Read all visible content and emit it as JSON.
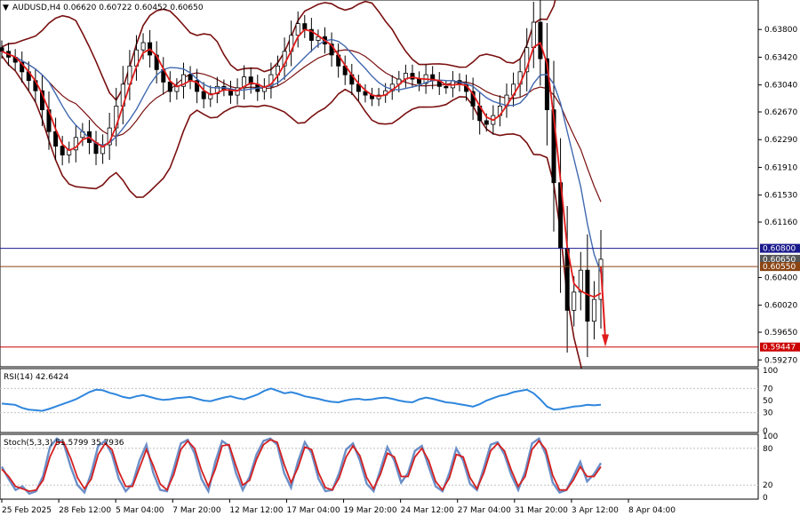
{
  "header": {
    "symbol_line": "AUDUSD,H4  0.06620 0.60722 0.60452 0.60650",
    "caret": "▼"
  },
  "chart_data": [
    {
      "type": "candlestick",
      "pane": "price",
      "symbol": "AUDUSD",
      "timeframe": "H4",
      "ohlc": {
        "open": 0.6062,
        "high": 0.60722,
        "low": 0.60452,
        "close": 0.6065
      },
      "ylim": [
        0.592,
        0.6418
      ],
      "y_ticks": [
        "0.63800",
        "0.63420",
        "0.63040",
        "0.62670",
        "0.62290",
        "0.61910",
        "0.61530",
        "0.61160",
        "0.60400",
        "0.60020",
        "0.59650",
        "0.59270"
      ],
      "x_ticks": [
        "25 Feb 2025",
        "28 Feb 12:00",
        "5 Mar 04:00",
        "7 Mar 20:00",
        "12 Mar 12:00",
        "17 Mar 04:00",
        "19 Mar 20:00",
        "24 Mar 12:00",
        "27 Mar 04:00",
        "31 Mar 20:00",
        "3 Apr 12:00",
        "8 Apr 04:00"
      ],
      "path_close": [
        0.635,
        0.6342,
        0.6335,
        0.6322,
        0.631,
        0.6296,
        0.627,
        0.624,
        0.622,
        0.6208,
        0.6215,
        0.6232,
        0.624,
        0.6225,
        0.621,
        0.6222,
        0.6245,
        0.6275,
        0.6305,
        0.633,
        0.6352,
        0.6362,
        0.6345,
        0.6325,
        0.6308,
        0.6295,
        0.6302,
        0.6318,
        0.631,
        0.6295,
        0.6285,
        0.6292,
        0.6302,
        0.6298,
        0.629,
        0.63,
        0.6315,
        0.6305,
        0.6295,
        0.6302,
        0.6318,
        0.633,
        0.635,
        0.6372,
        0.6388,
        0.638,
        0.6365,
        0.637,
        0.636,
        0.6345,
        0.633,
        0.6318,
        0.6305,
        0.6295,
        0.629,
        0.6285,
        0.629,
        0.6296,
        0.6305,
        0.6312,
        0.632,
        0.6312,
        0.6306,
        0.6318,
        0.631,
        0.6302,
        0.63,
        0.631,
        0.6305,
        0.6295,
        0.6275,
        0.6255,
        0.625,
        0.6262,
        0.6275,
        0.629,
        0.6305,
        0.6322,
        0.6355,
        0.639,
        0.634,
        0.627,
        0.617,
        0.608,
        0.5995,
        0.602,
        0.605,
        0.598,
        0.601,
        0.6065
      ],
      "lines": {
        "ema_red": "close smoothing, red",
        "ma_blue": "slower moving average, steel blue",
        "bollinger": "upper/lower bands, dark red"
      },
      "horizontal_levels": [
        {
          "price": 0.608,
          "label": "0.60800",
          "color": "#1a1a8c"
        },
        {
          "price": 0.6065,
          "label": "0.60650",
          "color": "#555555"
        },
        {
          "price": 0.6055,
          "label": "0.60550",
          "color": "#8b4513"
        },
        {
          "price": 0.59447,
          "label": "0.59447",
          "color": "#cc0000"
        }
      ]
    },
    {
      "type": "line",
      "pane": "rsi",
      "title": "RSI(14) 42.6424",
      "ylim": [
        0,
        100
      ],
      "y_ticks": [
        "100",
        "70",
        "50",
        "30",
        "0"
      ],
      "values": [
        45,
        44,
        43,
        38,
        35,
        34,
        33,
        36,
        40,
        44,
        48,
        52,
        58,
        64,
        68,
        67,
        63,
        60,
        56,
        54,
        57,
        59,
        56,
        53,
        51,
        52,
        54,
        55,
        56,
        53,
        50,
        49,
        52,
        55,
        57,
        54,
        52,
        56,
        60,
        66,
        70,
        66,
        62,
        64,
        61,
        57,
        55,
        53,
        50,
        48,
        47,
        50,
        52,
        53,
        51,
        52,
        54,
        55,
        53,
        50,
        48,
        47,
        52,
        55,
        53,
        50,
        47,
        46,
        44,
        42,
        40,
        44,
        50,
        54,
        58,
        60,
        64,
        66,
        68,
        62,
        52,
        40,
        35,
        36,
        38,
        40,
        41,
        43,
        42,
        43
      ]
    },
    {
      "type": "line",
      "pane": "stochastic",
      "title": "Stoch(5,3,3) 51.5799 35.7936",
      "ylim": [
        0,
        100
      ],
      "y_ticks": [
        "100",
        "80",
        "20",
        "0"
      ],
      "series": [
        {
          "name": "main",
          "color": "#6b8fc8",
          "values": [
            50,
            30,
            12,
            18,
            6,
            10,
            35,
            82,
            96,
            88,
            50,
            20,
            8,
            40,
            84,
            92,
            70,
            30,
            10,
            22,
            60,
            86,
            40,
            12,
            10,
            48,
            88,
            94,
            72,
            30,
            10,
            58,
            92,
            84,
            40,
            12,
            34,
            70,
            92,
            96,
            86,
            40,
            16,
            58,
            90,
            72,
            30,
            10,
            12,
            40,
            78,
            88,
            60,
            22,
            10,
            46,
            82,
            60,
            24,
            40,
            76,
            84,
            50,
            18,
            10,
            40,
            80,
            60,
            22,
            12,
            48,
            86,
            90,
            70,
            36,
            12,
            42,
            88,
            96,
            70,
            24,
            8,
            12,
            34,
            58,
            26,
            38,
            56
          ]
        },
        {
          "name": "signal",
          "color": "#d42020",
          "values": [
            46,
            34,
            18,
            14,
            10,
            12,
            28,
            66,
            90,
            90,
            64,
            32,
            14,
            30,
            70,
            88,
            78,
            42,
            18,
            18,
            48,
            78,
            52,
            22,
            12,
            38,
            78,
            92,
            80,
            44,
            18,
            46,
            84,
            86,
            52,
            20,
            28,
            62,
            86,
            94,
            90,
            54,
            24,
            48,
            82,
            78,
            40,
            16,
            12,
            32,
            66,
            84,
            68,
            32,
            14,
            38,
            72,
            66,
            34,
            34,
            66,
            80,
            60,
            26,
            12,
            32,
            70,
            66,
            32,
            14,
            40,
            76,
            88,
            76,
            44,
            18,
            34,
            78,
            92,
            78,
            36,
            12,
            12,
            28,
            50,
            34,
            34,
            50
          ]
        }
      ]
    }
  ],
  "colors": {
    "up_candle": "#ffffff",
    "candle_edge": "#000000",
    "ema": "#e01b1b",
    "ma": "#4169b0",
    "bands": "#7a1010",
    "rsi": "#2e86de"
  }
}
